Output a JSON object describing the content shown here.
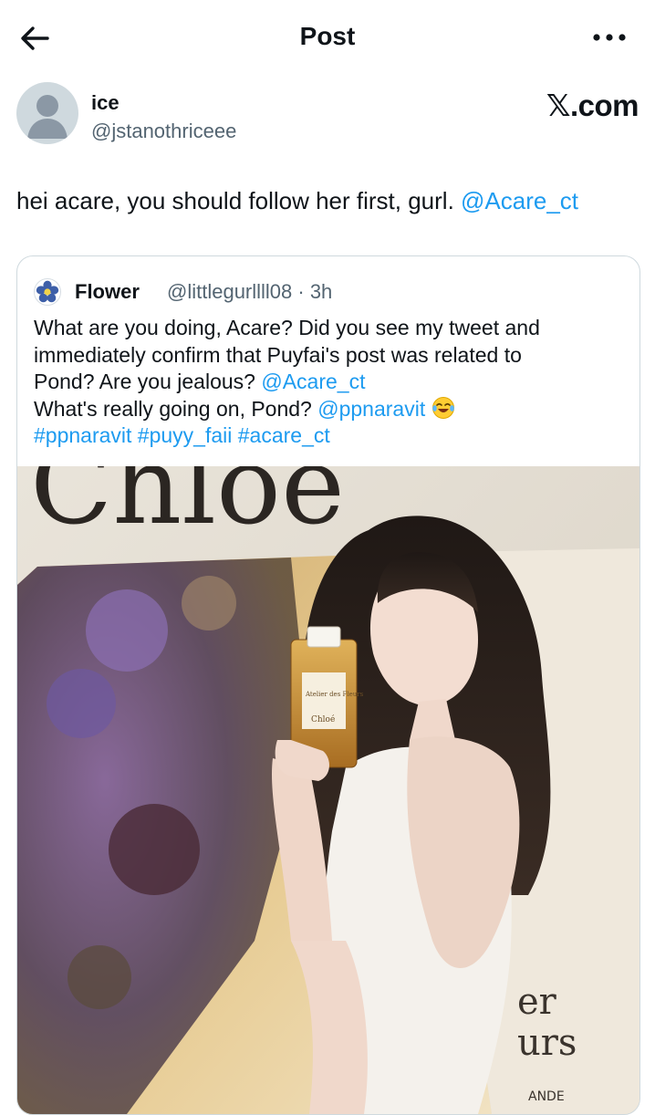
{
  "header": {
    "title": "Post"
  },
  "author": {
    "name": "ice",
    "handle": "@jstanothriceee",
    "brand": "𝕏.com"
  },
  "tweet": {
    "text": "hei acare, you should follow her first, gurl. ",
    "mention": "@Acare_ct"
  },
  "quote": {
    "name": "Flower",
    "meta": "@littlegurllll08 · 3h",
    "line1": "What are you doing, Acare? Did you see my tweet and",
    "line2": "immediately confirm that Puyfai's post was related to",
    "line3_text": "Pond? Are you jealous? ",
    "line3_mention": "@Acare_ct",
    "line4_text": "What's really going on, Pond? ",
    "line4_mention": "@ppnaravit",
    "hashtags": "#ppnaravit #puyy_faii #acare_ct"
  },
  "photo": {
    "bg_text_top": "Chloé",
    "bottle_label": "Atelier des Fleurs",
    "bottle_brand": "Chloé",
    "poster_text_1": "er",
    "poster_text_2": "urs",
    "poster_text_3": "ANDE"
  },
  "colors": {
    "link": "#1d9bf0",
    "muted": "#536471",
    "border": "#cfd9de",
    "text": "#0f1419"
  }
}
